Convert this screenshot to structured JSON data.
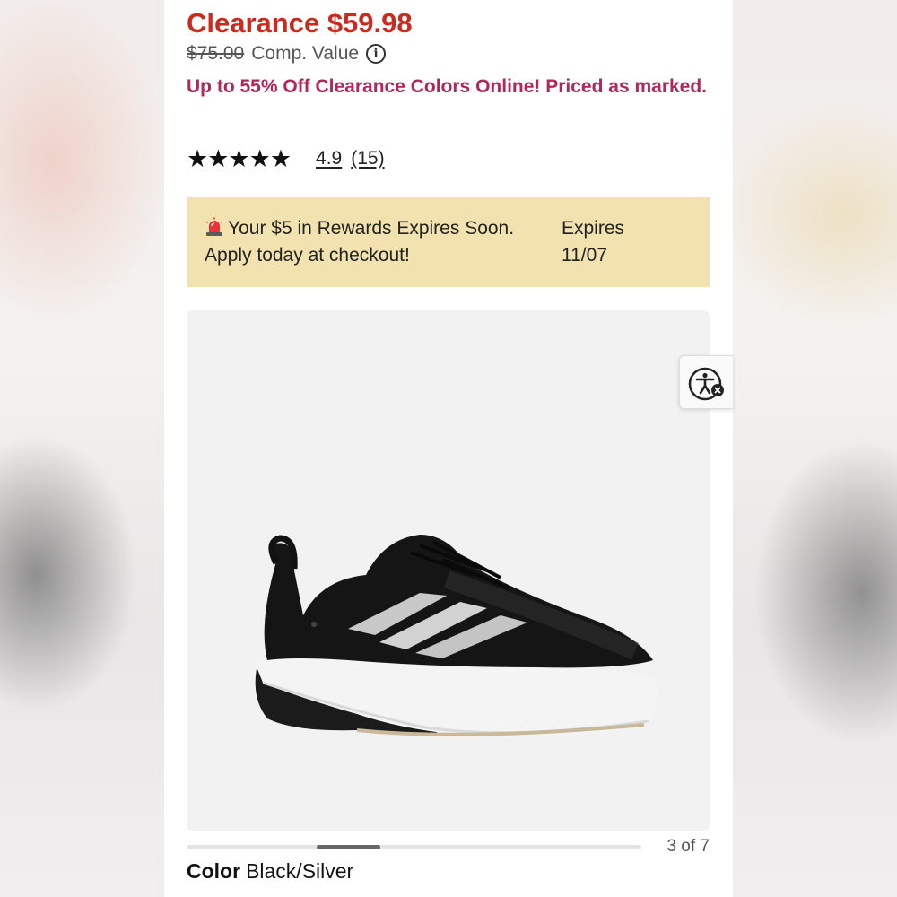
{
  "product": {
    "price_label": "Clearance $59.98",
    "comp_price": "$75.00",
    "comp_label": "Comp. Value",
    "promo_text": "Up to 55% Off Clearance Colors Online! Priced as marked.",
    "rating": {
      "stars": "★★★★★",
      "score": "4.9",
      "count": "(15)",
      "value": 4.9,
      "max": 5
    }
  },
  "rewards_banner": {
    "message": "Your $5 in Rewards Expires Soon. Apply today at checkout!",
    "expires_label": "Expires",
    "expires_date": "11/07",
    "icon": "siren-icon",
    "background": "#f1e2b0"
  },
  "gallery": {
    "counter": "3 of 7",
    "current": 3,
    "total": 7
  },
  "color": {
    "label": "Color",
    "value": "Black/Silver"
  },
  "colors": {
    "price_red": "#cc2a1f",
    "promo_magenta": "#b3265a"
  },
  "icons": [
    "info-icon",
    "star-icon",
    "siren-icon",
    "accessibility-icon"
  ]
}
